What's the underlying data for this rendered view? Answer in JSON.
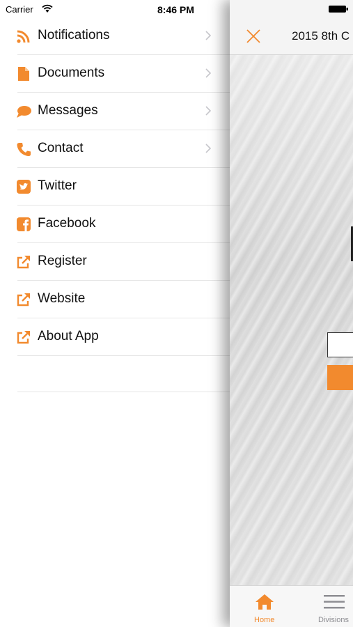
{
  "status_bar": {
    "carrier": "Carrier",
    "time": "8:46 PM"
  },
  "colors": {
    "accent": "#f28a2e",
    "twitter": "#f28a2e",
    "facebook": "#f28a2e"
  },
  "menu": {
    "items": [
      {
        "label": "Notifications",
        "icon": "rss-icon",
        "has_chevron": true
      },
      {
        "label": "Documents",
        "icon": "document-icon",
        "has_chevron": true
      },
      {
        "label": "Messages",
        "icon": "chat-bubble-icon",
        "has_chevron": true
      },
      {
        "label": "Contact",
        "icon": "phone-icon",
        "has_chevron": true
      },
      {
        "label": "Twitter",
        "icon": "twitter-icon",
        "has_chevron": false
      },
      {
        "label": "Facebook",
        "icon": "facebook-icon",
        "has_chevron": false
      },
      {
        "label": "Register",
        "icon": "external-link-icon",
        "has_chevron": false
      },
      {
        "label": "Website",
        "icon": "external-link-icon",
        "has_chevron": false
      },
      {
        "label": "About App",
        "icon": "external-link-icon",
        "has_chevron": false
      }
    ]
  },
  "content": {
    "title": "2015 8th C",
    "tabs": [
      {
        "label": "Home",
        "icon": "home-icon",
        "active": true
      },
      {
        "label": "Divisions",
        "icon": "menu-icon",
        "active": false
      }
    ]
  }
}
